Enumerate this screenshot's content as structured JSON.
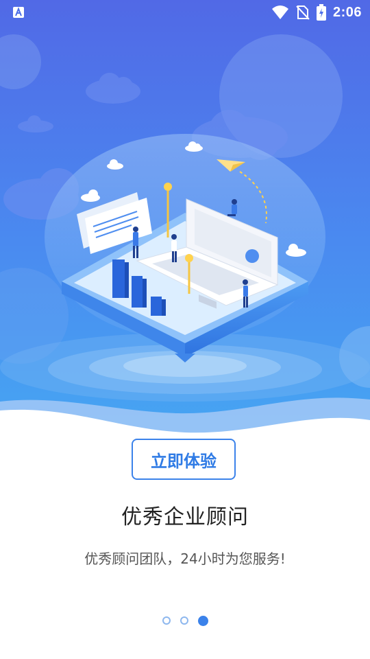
{
  "status_bar": {
    "time": "2:06",
    "icons": [
      "app-notification-icon",
      "wifi-icon",
      "no-sim-icon",
      "battery-charging-icon"
    ]
  },
  "onboarding": {
    "cta_label": "立即体验",
    "title": "优秀企业顾问",
    "subtitle": "优秀顾问团队，24小时为您服务!",
    "pager": {
      "total": 3,
      "current": 3
    }
  },
  "colors": {
    "accent": "#3b82ea",
    "hero_top": "#4e74ea",
    "hero_bottom": "#3aa0f0"
  }
}
